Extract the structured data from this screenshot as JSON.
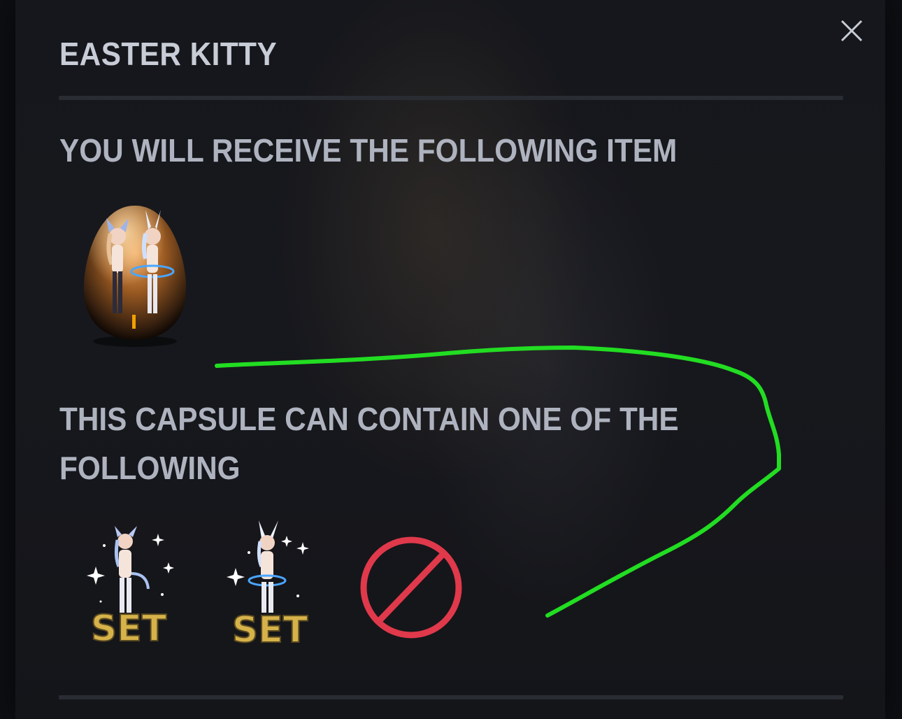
{
  "dialog": {
    "title": "EASTER KITTY",
    "close_icon": "close-icon"
  },
  "receive_section": {
    "heading": "YOU WILL RECEIVE THE FOLLOWING ITEM",
    "items": [
      {
        "icon": "easter-egg-capsule-icon",
        "badge": "I"
      }
    ]
  },
  "contain_section": {
    "heading": "THIS CAPSULE CAN CONTAIN ONE OF THE FOLLOWING",
    "items": [
      {
        "icon": "kitty-outfit-set-icon",
        "label": "SET"
      },
      {
        "icon": "bunny-outfit-set-icon",
        "label": "SET"
      },
      {
        "icon": "prohibited-icon"
      }
    ]
  },
  "colors": {
    "annotation_stroke": "#22dd22",
    "prohibited_red": "#e0394b",
    "title_text": "#c8ccd6",
    "heading_text": "#aeb3bf"
  }
}
